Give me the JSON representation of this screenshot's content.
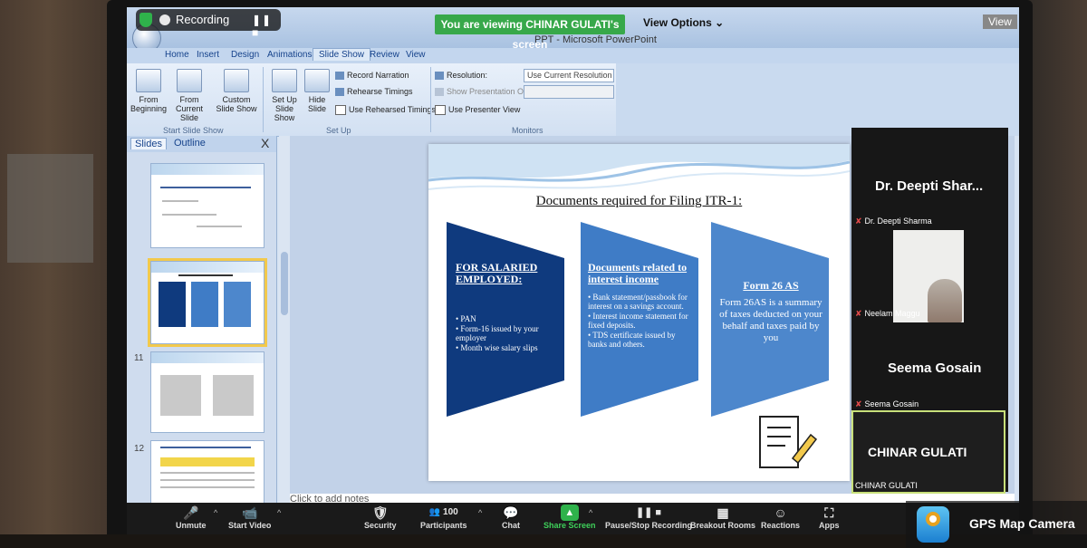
{
  "zoom": {
    "recording_label": "Recording",
    "pause_glyph": "❚❚ ■",
    "viewing_banner": "You are viewing CHINAR GULATI's screen",
    "view_options": "View Options ⌄",
    "view_right": "View",
    "toolbar": [
      {
        "id": "unmute",
        "label": "Unmute",
        "icon": "🎤"
      },
      {
        "id": "start-video",
        "label": "Start Video",
        "icon": "📹"
      },
      {
        "id": "security",
        "label": "Security",
        "icon": "🛡"
      },
      {
        "id": "participants",
        "label": "Participants",
        "icon": "👥 100"
      },
      {
        "id": "chat",
        "label": "Chat",
        "icon": "💬"
      },
      {
        "id": "share-screen",
        "label": "Share Screen",
        "icon": "▲"
      },
      {
        "id": "pause-stop-recording",
        "label": "Pause/Stop Recording",
        "icon": "❚❚ ■"
      },
      {
        "id": "breakout-rooms",
        "label": "Breakout Rooms",
        "icon": "▦"
      },
      {
        "id": "reactions",
        "label": "Reactions",
        "icon": "☺"
      },
      {
        "id": "apps",
        "label": "Apps",
        "icon": "⛶"
      }
    ],
    "gallery": {
      "tile1_name": "Dr. Deepti Shar...",
      "tile1_label": "Dr. Deepti Sharma",
      "tile2_label": "Neelam Maggu",
      "tile3_name": "Seema Gosain",
      "tile3_label": "Seema Gosain",
      "tile4_name": "CHINAR GULATI",
      "tile4_label": "CHINAR GULATI"
    }
  },
  "ppt": {
    "window_title": "PPT - Microsoft PowerPoint",
    "tabs": [
      "Home",
      "Insert",
      "Design",
      "Animations",
      "Slide Show",
      "Review",
      "View"
    ],
    "ribbon": {
      "from_beginning": "From Beginning",
      "from_current": "From Current Slide",
      "custom": "Custom Slide Show",
      "start_group": "Start Slide Show",
      "set_up": "Set Up Slide Show",
      "hide": "Hide Slide",
      "record": "Record Narration",
      "rehearse": "Rehearse Timings",
      "use_rehearsed": "Use Rehearsed Timings",
      "setup_group": "Set Up",
      "resolution": "Resolution:",
      "resolution_value": "Use Current Resolution",
      "show_on": "Show Presentation On:",
      "presenter": "Use Presenter View",
      "monitors_group": "Monitors"
    },
    "pane_tabs": [
      "Slides",
      "Outline"
    ],
    "pane_close": "X",
    "thumb_numbers": [
      "11",
      "12"
    ],
    "notes_placeholder": "Click to add notes"
  },
  "slide": {
    "title": "Documents required for Filing ITR-1:",
    "block1_head": "FOR SALARIED EMPLOYED:",
    "block1_items": [
      "• PAN",
      "• Form-16 issued by your employer",
      "• Month wise salary slips"
    ],
    "block2_head": "Documents related to interest income",
    "block2_items": [
      "• Bank statement/passbook for interest on a savings account.",
      "• Interest income statement for fixed deposits.",
      "• TDS certificate issued by banks and others."
    ],
    "block3_head": "Form 26 AS",
    "block3_body": "Form 26AS is a summary of taxes deducted on your behalf and taxes paid by you"
  },
  "overlay": {
    "gps_text": "GPS Map Camera"
  },
  "colors": {
    "dark_blue": "#0f3a7e",
    "mid_blue": "#3f7cc6",
    "light_blue": "#4d87cc",
    "zoom_green": "#2fb24b"
  }
}
